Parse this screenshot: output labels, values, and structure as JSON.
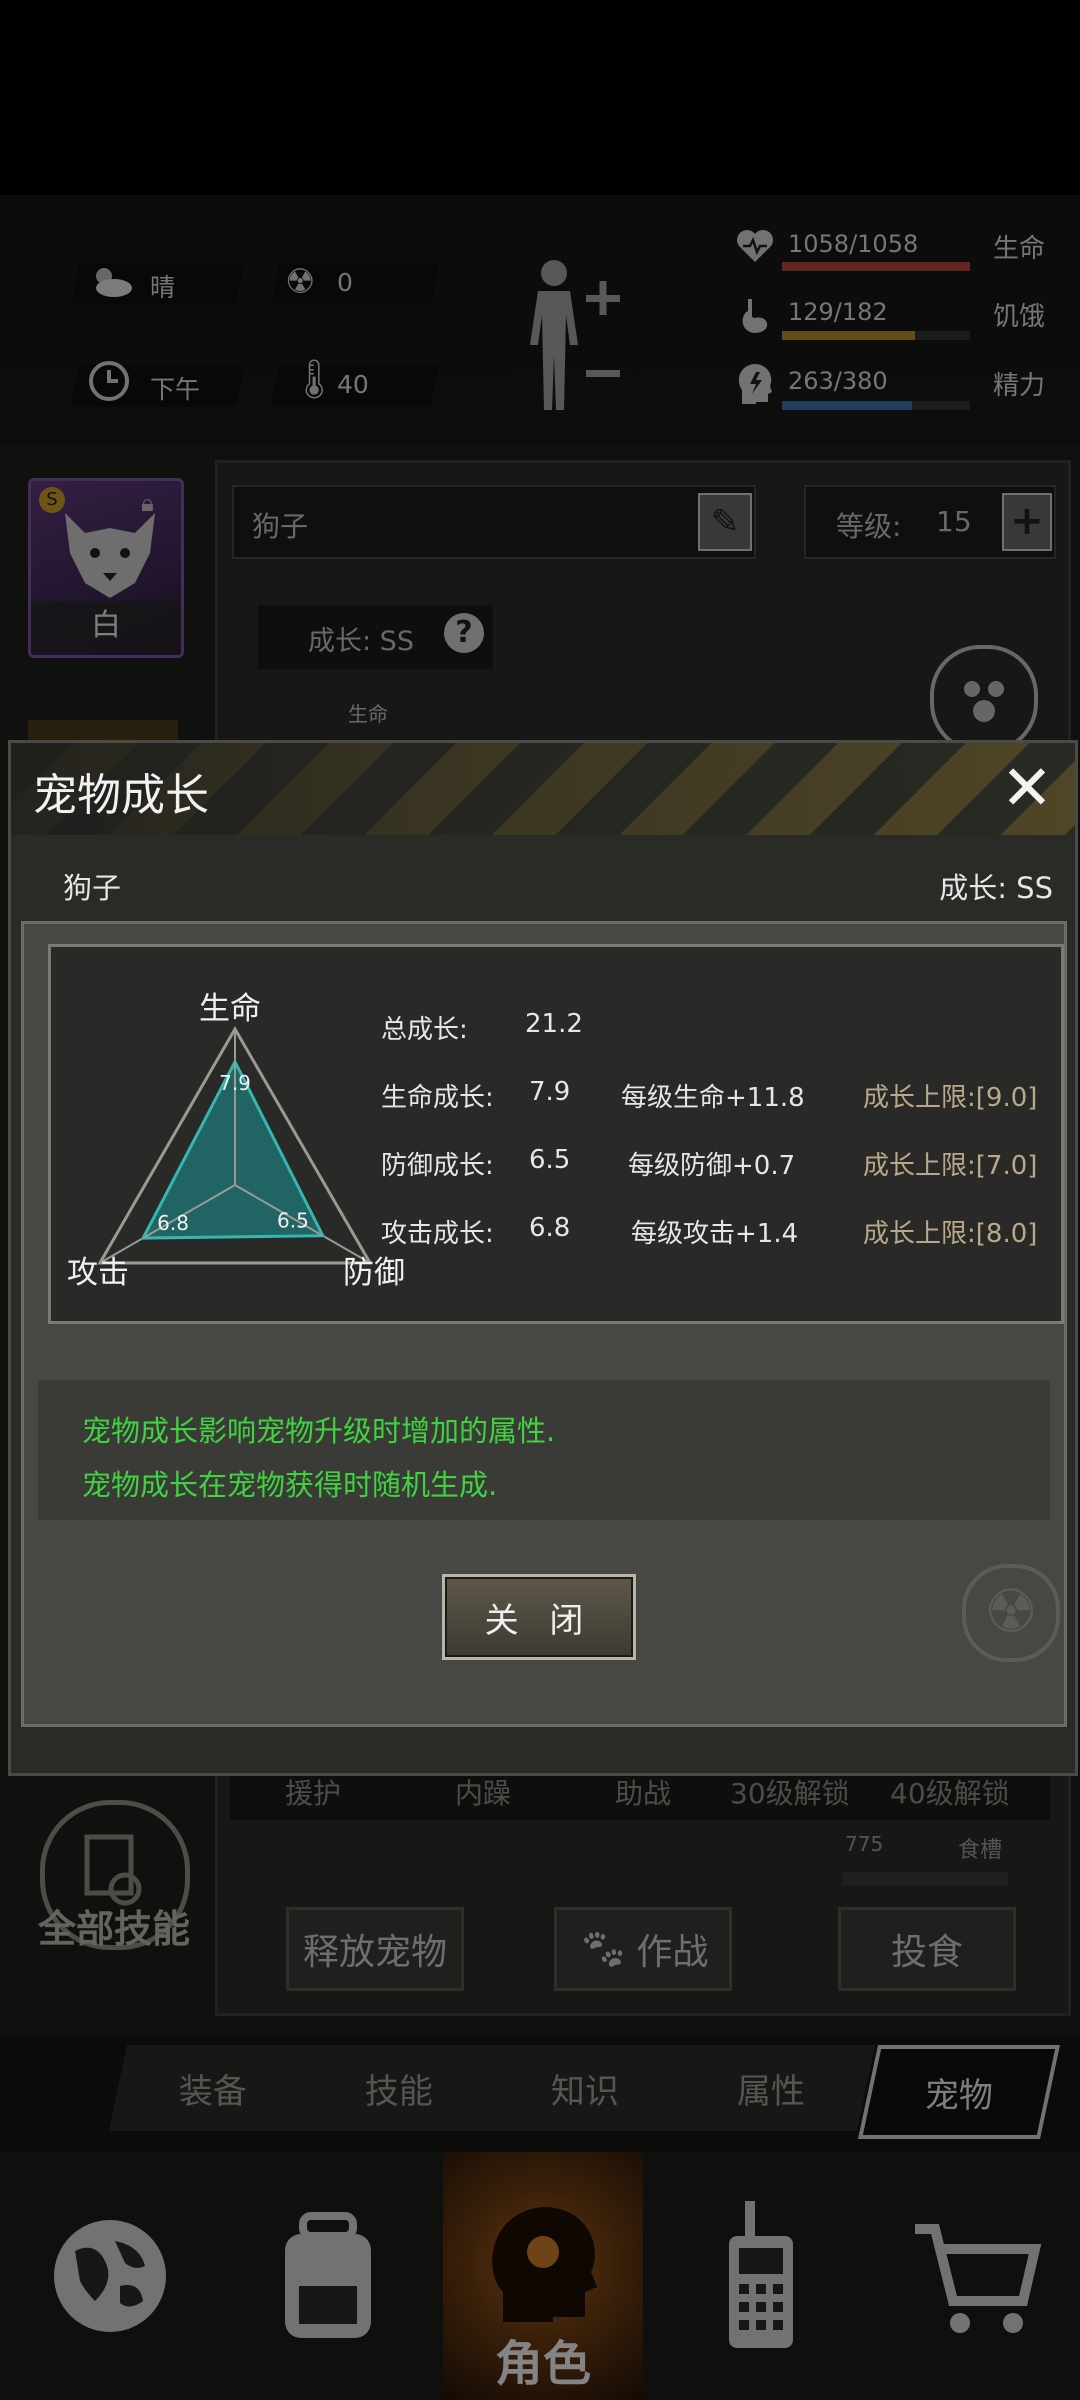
{
  "status": {
    "weather": "晴",
    "radiation": "0",
    "time_of_day": "下午",
    "temperature": "40",
    "health": {
      "label": "生命",
      "value": "1058/1058",
      "fraction": 1.0,
      "color": "#b0453a"
    },
    "hunger": {
      "label": "饥饿",
      "value": "129/182",
      "fraction": 0.709,
      "color": "#b58a2a"
    },
    "energy": {
      "label": "精力",
      "value": "263/380",
      "fraction": 0.692,
      "color": "#3b6fa6"
    }
  },
  "pet_panel": {
    "card_label": "白",
    "name": "狗子",
    "level_label": "等级:",
    "level_value": "15",
    "growth_label": "成长: SS",
    "mini_chart_label": "生命",
    "columns": [
      "援护",
      "内躁",
      "助战",
      "30级解锁",
      "40级解锁"
    ],
    "food_value": "775",
    "food_label": "食槽",
    "all_skills": "全部技能",
    "release_button": "释放宠物",
    "fight_button": "作战",
    "feed_button": "投食"
  },
  "modal": {
    "title": "宠物成长",
    "pet_name": "狗子",
    "grade": "成长: SS",
    "total_label": "总成长:",
    "total_value": "21.2",
    "rows": [
      {
        "label": "生命成长:",
        "value": "7.9",
        "per_level": "每级生命+11.8",
        "limit": "成长上限:[9.0]"
      },
      {
        "label": "防御成长:",
        "value": "6.5",
        "per_level": "每级防御+0.7",
        "limit": "成长上限:[7.0]"
      },
      {
        "label": "攻击成长:",
        "value": "6.8",
        "per_level": "每级攻击+1.4",
        "limit": "成长上限:[8.0]"
      }
    ],
    "description": [
      "宠物成长影响宠物升级时增加的属性.",
      "宠物成长在宠物获得时随机生成."
    ],
    "close_button": "关 闭"
  },
  "chart_data": {
    "type": "radar",
    "axes": [
      "生命",
      "防御",
      "攻击"
    ],
    "values": [
      7.9,
      6.5,
      6.8
    ],
    "value_labels": [
      "7.9",
      "6.5",
      "6.8"
    ],
    "max": 10,
    "fill_color": "#1f6f6f",
    "line_color": "#35b6b0"
  },
  "tabs": [
    "装备",
    "技能",
    "知识",
    "属性",
    "宠物"
  ],
  "active_tab": "宠物",
  "bottom_nav": {
    "active_label": "角色"
  }
}
